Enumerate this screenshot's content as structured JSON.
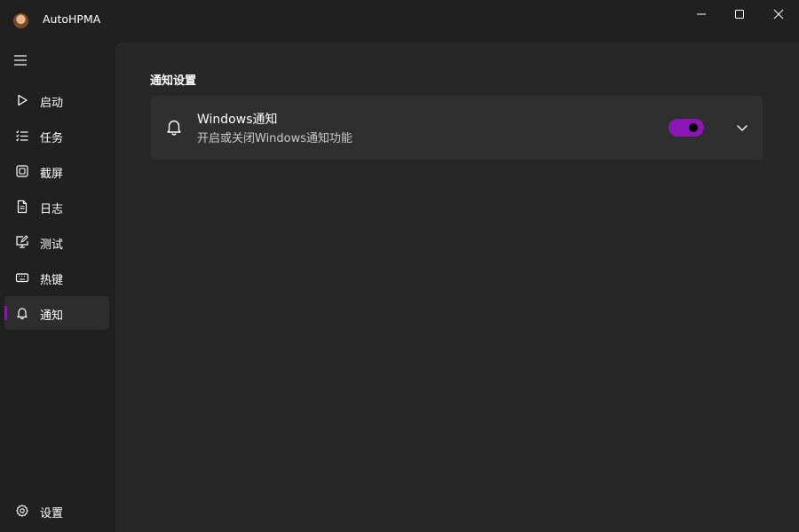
{
  "window": {
    "title": "AutoHPMA",
    "app_icon": "app-avatar-icon",
    "controls": [
      "minimize-icon",
      "maximize-icon",
      "close-icon"
    ]
  },
  "sidebar": {
    "menu_icon": "hamburger-icon",
    "items": [
      {
        "label": "启动",
        "icon": "play-icon"
      },
      {
        "label": "任务",
        "icon": "task-list-icon"
      },
      {
        "label": "截屏",
        "icon": "screenshot-icon"
      },
      {
        "label": "日志",
        "icon": "document-icon"
      },
      {
        "label": "测试",
        "icon": "monitor-edit-icon"
      },
      {
        "label": "热键",
        "icon": "keyboard-icon"
      },
      {
        "label": "通知",
        "icon": "bell-icon",
        "selected": true
      }
    ],
    "footer": {
      "label": "设置",
      "icon": "gear-icon"
    }
  },
  "main": {
    "section_title": "通知设置",
    "card": {
      "icon": "bell-icon",
      "title": "Windows通知",
      "description": "开启或关闭Windows通知功能",
      "toggle_on": true,
      "expand_icon": "chevron-down-icon"
    }
  },
  "colors": {
    "accent": "#8a17b3",
    "window_bg": "#202020",
    "content_bg": "#272727",
    "card_bg": "#2f2f2f"
  }
}
